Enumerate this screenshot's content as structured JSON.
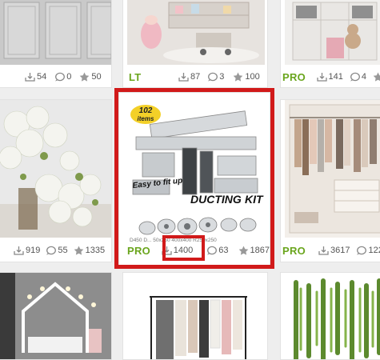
{
  "colors": {
    "badge": "#6aa51d",
    "highlight": "#d11a1a",
    "page_bg": "#eeeeee"
  },
  "icons": {
    "downloads": "download-icon",
    "comments": "comment-icon",
    "rating": "star-icon"
  },
  "cards": {
    "r1c1": {
      "downloads": "54",
      "comments": "0",
      "rating": "50",
      "badge": ""
    },
    "r1c2": {
      "downloads": "87",
      "comments": "3",
      "rating": "100",
      "badge": "LT"
    },
    "r1c3": {
      "downloads": "141",
      "comments": "4",
      "rating": "",
      "badge": "PRO"
    },
    "r2c1": {
      "downloads": "919",
      "comments": "55",
      "rating": "1335",
      "badge": ""
    },
    "r2c2": {
      "downloads": "1400",
      "comments": "63",
      "rating": "1867",
      "badge": "PRO",
      "image_text": {
        "count": "102",
        "unit": "items",
        "tagline": "Easy to fit up",
        "title_a": "DUCTING",
        "title_b": "KIT",
        "specs": "D450 D... 50x250 400x400 R250x250"
      }
    },
    "r2c3": {
      "downloads": "3617",
      "comments": "122",
      "rating": "",
      "badge": "PRO"
    }
  }
}
